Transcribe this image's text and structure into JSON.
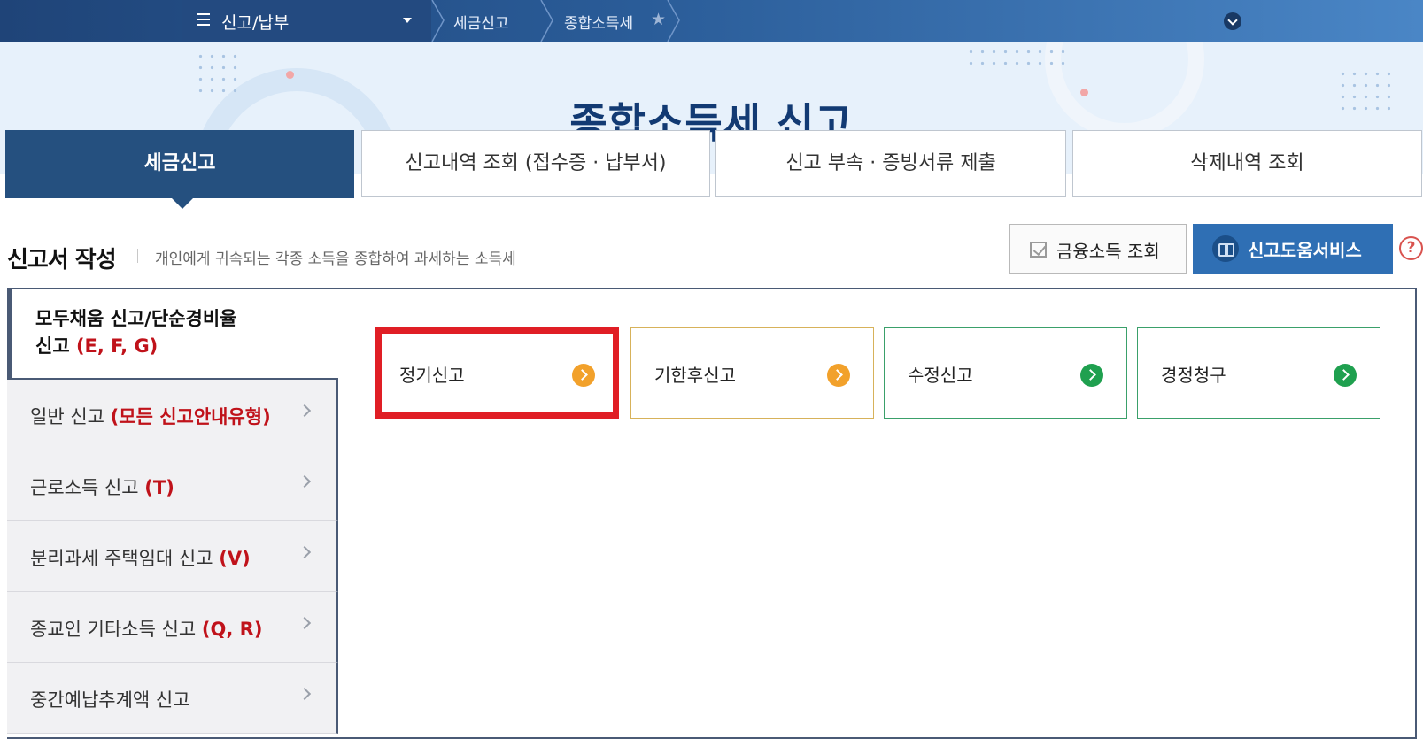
{
  "nav": {
    "menu_label": "신고/납부",
    "breadcrumbs": [
      "세금신고",
      "종합소득세"
    ],
    "colors": {
      "bar_start": "#1f4478",
      "bar_end": "#4a86c6"
    }
  },
  "hero": {
    "title": "종합소득세 신고"
  },
  "tabs": [
    {
      "label": "세금신고",
      "active": true
    },
    {
      "label": "신고내역 조회 (접수증 · 납부서)",
      "active": false
    },
    {
      "label": "신고 부속 · 증빙서류 제출",
      "active": false
    },
    {
      "label": "삭제내역 조회",
      "active": false
    }
  ],
  "section": {
    "title": "신고서 작성",
    "description": "개인에게 귀속되는 각종 소득을 종합하여 과세하는 소득세",
    "finance_button": "금융소득 조회",
    "help_button": "신고도움서비스",
    "help_icon_text": "?"
  },
  "sidebar": {
    "first": {
      "line1": "모두채움 신고/단순경비율",
      "line2": "신고",
      "code": "(E, F, G)"
    },
    "items": [
      {
        "label": "일반 신고",
        "code": "(모든 신고안내유형)"
      },
      {
        "label": "근로소득 신고",
        "code": "(T)"
      },
      {
        "label": "분리과세 주택임대 신고",
        "code": "(V)"
      },
      {
        "label": "종교인 기타소득 신고",
        "code": "(Q, R)"
      },
      {
        "label": "중간예납추계액 신고",
        "code": ""
      }
    ]
  },
  "cards": [
    {
      "label": "정기신고",
      "color": "orange",
      "selected": true
    },
    {
      "label": "기한후신고",
      "color": "orange",
      "selected": false
    },
    {
      "label": "수정신고",
      "color": "green",
      "selected": false
    },
    {
      "label": "경정청구",
      "color": "green",
      "selected": false
    }
  ],
  "colors": {
    "accent_dark": "#25507f",
    "accent_blue": "#2f6fb4",
    "code_red": "#c0121a",
    "highlight": "#e01e25",
    "orange": "#f2a12b",
    "green": "#1fa04f"
  }
}
